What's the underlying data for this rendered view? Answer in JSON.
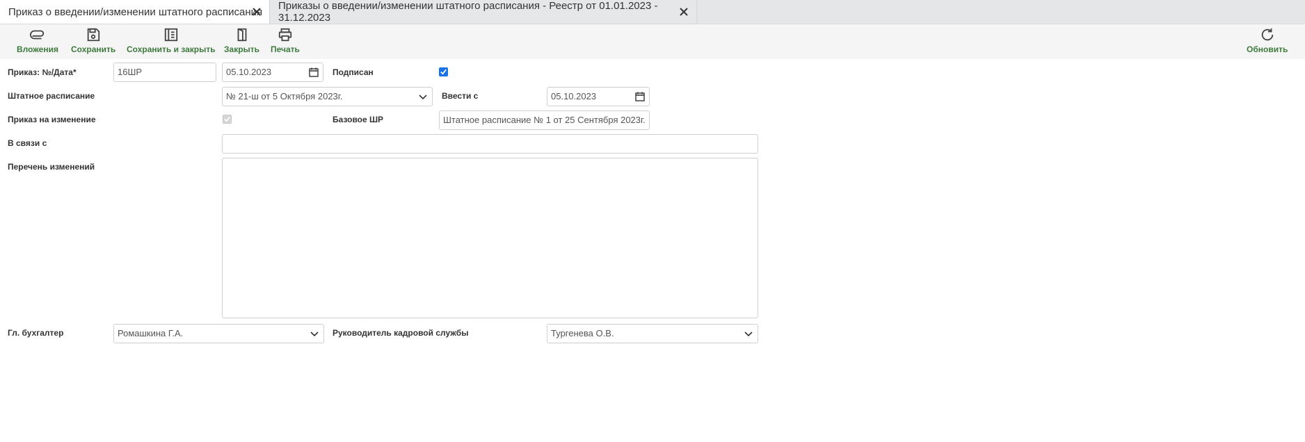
{
  "tabs": [
    {
      "label": "Приказ о введении/изменении штатного расписания"
    },
    {
      "label": "Приказы о введении/изменении штатного расписания - Реестр от 01.01.2023 - 31.12.2023"
    }
  ],
  "toolbar": {
    "attachments": "Вложения",
    "save": "Сохранить",
    "save_close": "Сохранить и закрыть",
    "close": "Закрыть",
    "print": "Печать",
    "refresh": "Обновить"
  },
  "form": {
    "order_label": "Приказ: №/Дата*",
    "order_number": "16ШР",
    "order_date": "05.10.2023",
    "signed_label": "Подписан",
    "signed": true,
    "staff_schedule_label": "Штатное расписание",
    "staff_schedule_value": "№ 21-ш от 5 Октября 2023г.",
    "effective_label": "Ввести с",
    "effective_date": "05.10.2023",
    "change_order_label": "Приказ на изменение",
    "change_order": true,
    "base_label": "Базовое ШР",
    "base_value": "Штатное расписание № 1 от 25 Сентября 2023г.",
    "reason_label": "В связи с",
    "reason_value": "",
    "changes_label": "Перечень изменений",
    "changes_value": "",
    "accountant_label": "Гл. бухгалтер",
    "accountant_value": "Ромашкина Г.А.",
    "hr_head_label": "Руководитель кадровой службы",
    "hr_head_value": "Тургенева О.В."
  }
}
